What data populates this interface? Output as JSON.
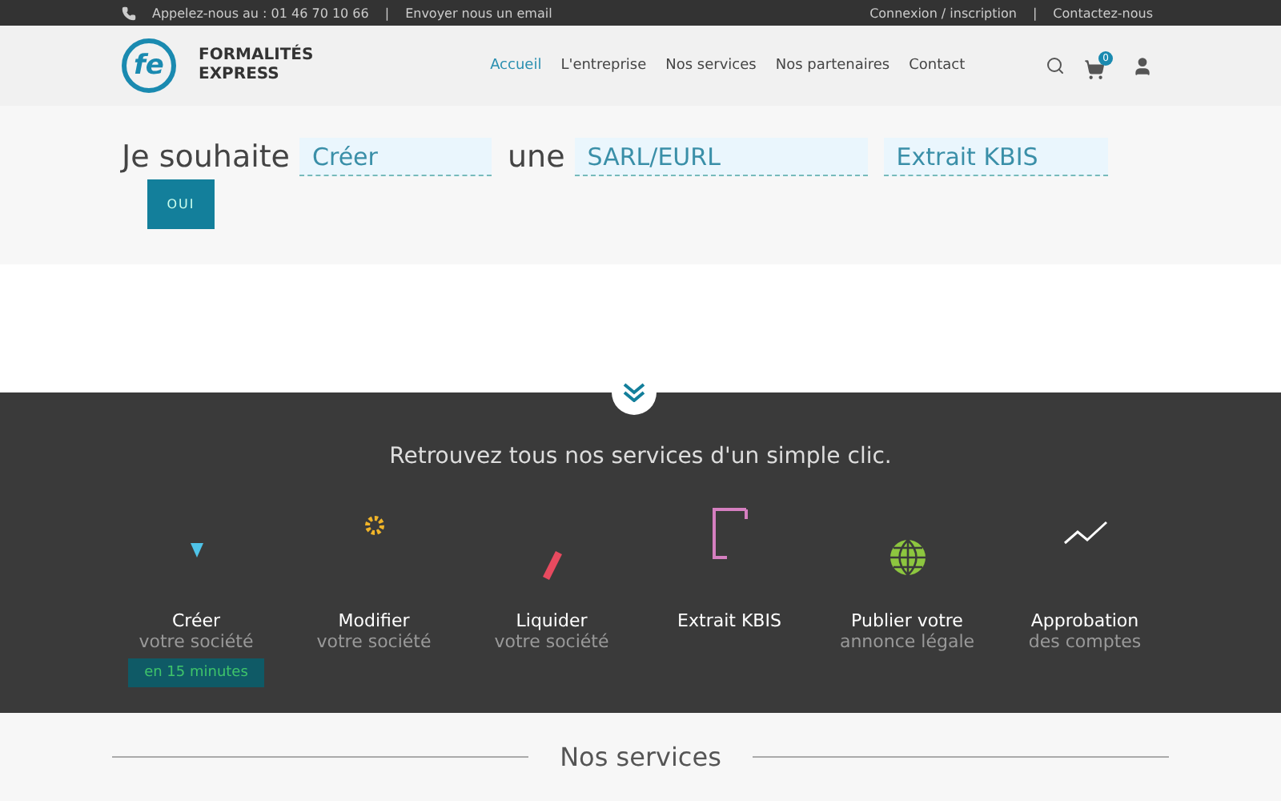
{
  "top_bar": {
    "phone": "Appelez-nous au : 01 46 70 10 66",
    "separator_1": "|",
    "email_link": "Envoyer nous un email",
    "login_link": "Connexion / inscription",
    "separator_2": "|",
    "contact_link": "Contactez-nous"
  },
  "header": {
    "logo_mark": "fe",
    "logo_line_1": "FORMALITÉS",
    "logo_line_2": "EXPRESS",
    "cart_count": "0",
    "nav": [
      {
        "label": "Accueil",
        "selected": true
      },
      {
        "label": "L'entreprise",
        "selected": false
      },
      {
        "label": "Nos services",
        "selected": false
      },
      {
        "label": "Nos partenaires",
        "selected": false
      },
      {
        "label": "Contact",
        "selected": false
      }
    ]
  },
  "hero": {
    "lead": "Je souhaite",
    "field_1": "Créer",
    "middle": "une",
    "field_2": "SARL/EURL",
    "field_3": "Extrait KBIS",
    "button": "OUI"
  },
  "services": {
    "heading": "Retrouvez tous nos services d'un simple clic.",
    "items": [
      {
        "kind": "drop",
        "title": "Créer",
        "subtitle": "votre société",
        "badge": "en 15 minutes",
        "color": "#4fc3e8"
      },
      {
        "kind": "gear",
        "title": "Modifier",
        "subtitle": "votre société",
        "color": "#f0b429"
      },
      {
        "kind": "pen",
        "title": "Liquider",
        "subtitle": "votre société",
        "color": "#e84a5f"
      },
      {
        "kind": "document",
        "title": "Extrait KBIS",
        "color": "#d57fc0"
      },
      {
        "kind": "globe",
        "title": "Publier votre",
        "subtitle": "annonce légale",
        "color": "#8dc63f"
      },
      {
        "kind": "chart",
        "title": "Approbation",
        "subtitle": "des comptes",
        "color": "#ffffff"
      }
    ]
  },
  "section_title": "Nos services"
}
